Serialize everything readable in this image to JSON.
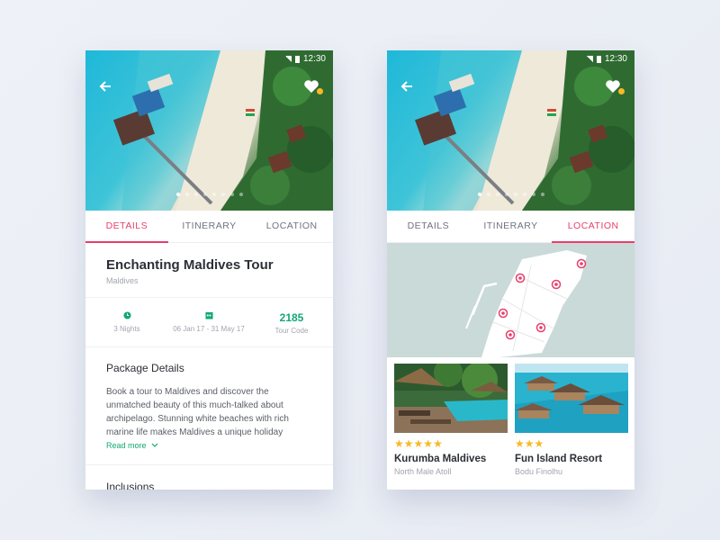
{
  "status": {
    "time": "12:30"
  },
  "tabs": [
    "DETAILS",
    "ITINERARY",
    "LOCATION"
  ],
  "tour": {
    "title": "Enchanting Maldives Tour",
    "subtitle": "Maldives",
    "nights": "3 Nights",
    "dates": "06 Jan 17 - 31 May 17",
    "code_value": "2185",
    "code_label": "Tour Code",
    "package_title": "Package Details",
    "package_text": "Book a tour to Maldives and discover the unmatched beauty of this much-talked about archipelago. Stunning white beaches with rich marine life makes Maldives a unique holiday",
    "read_more": "Read more",
    "inclusions": "Inclusions"
  },
  "resorts": [
    {
      "name": "Kurumba Maldives",
      "location": "North Male Atoll",
      "stars": 5
    },
    {
      "name": "Fun Island Resort",
      "location": "Bodu Finolhu",
      "stars": 3
    }
  ],
  "colors": {
    "accent": "#e83e6c",
    "green": "#12a974",
    "star": "#f7b924",
    "map_water": "#c9dad8"
  },
  "icons": {
    "back": "arrow-left-icon",
    "favorite": "heart-icon",
    "nights": "clock-icon",
    "dates": "calendar-icon"
  }
}
